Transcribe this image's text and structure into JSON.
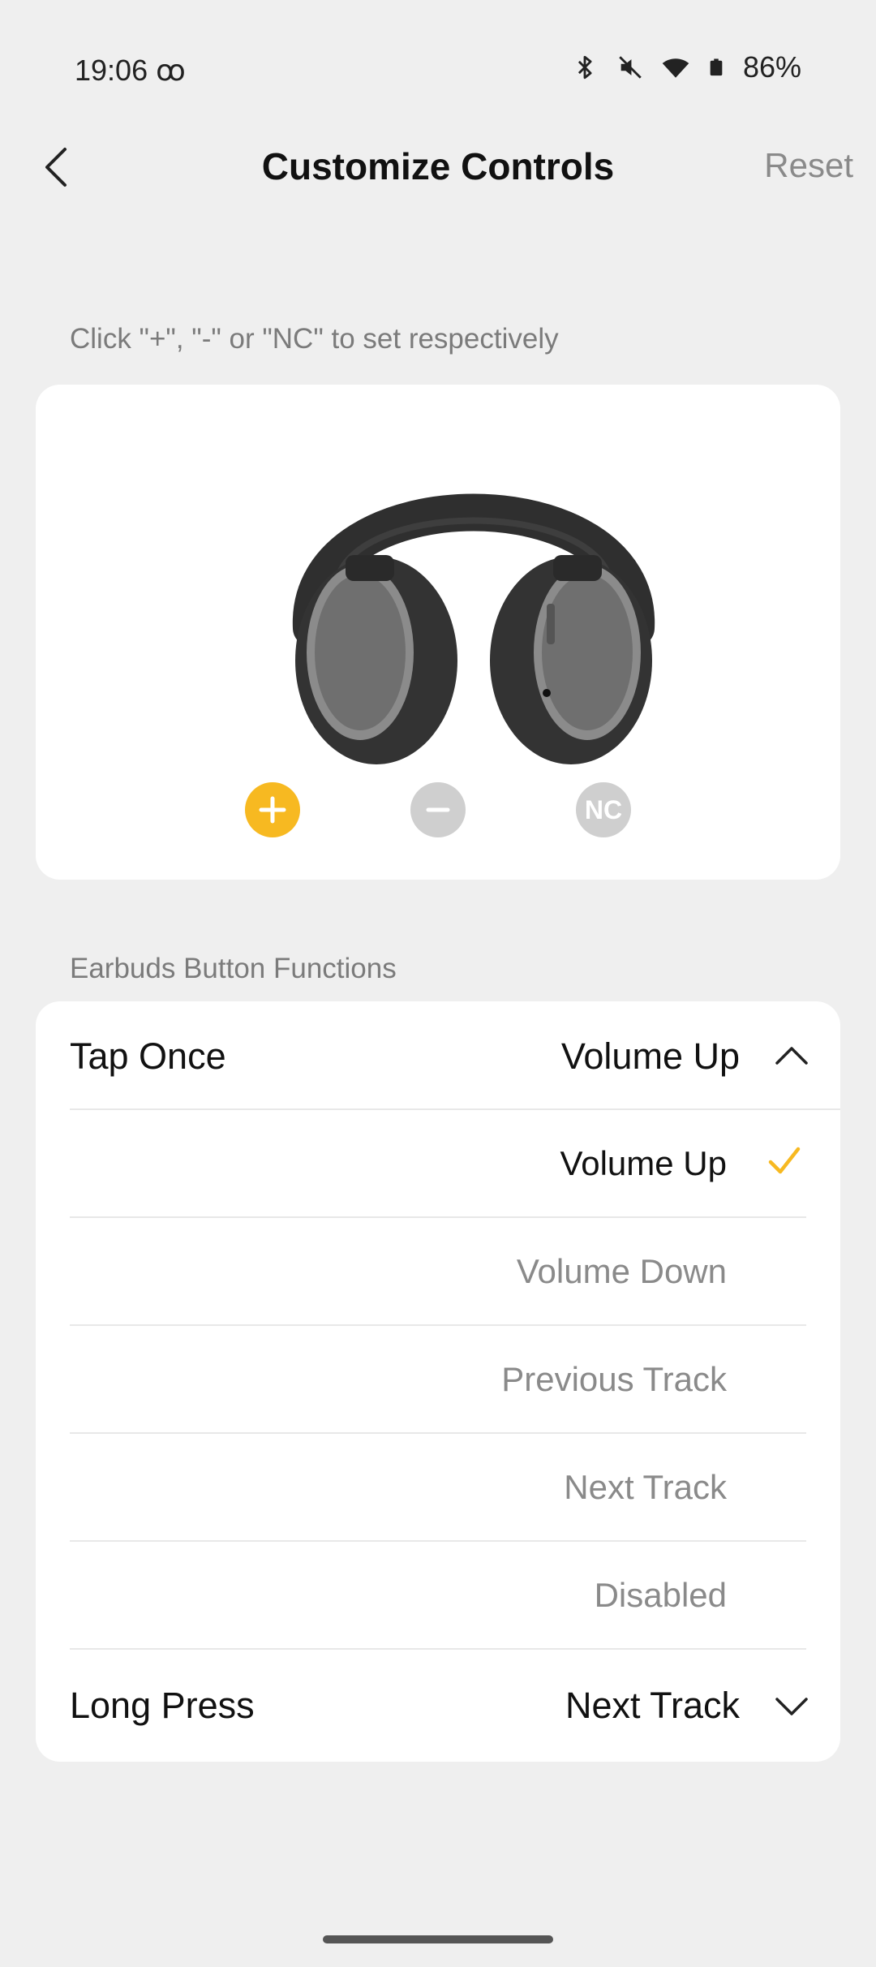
{
  "status_bar": {
    "time": "19:06",
    "carrier_glyph": "ꝏ",
    "battery_percent": "86%",
    "icons": [
      "bluetooth-icon",
      "mute-icon",
      "wifi-icon",
      "battery-icon"
    ]
  },
  "header": {
    "title": "Customize Controls",
    "reset_label": "Reset"
  },
  "hint": "Click \"+\", \"-\" or \"NC\" to set respectively",
  "controls": {
    "selected": "plus",
    "nc_label": "NC"
  },
  "section_label": "Earbuds Button Functions",
  "functions": {
    "tap_once": {
      "label": "Tap Once",
      "value": "Volume Up",
      "expanded": true
    },
    "options": [
      {
        "label": "Volume Up",
        "selected": true
      },
      {
        "label": "Volume Down",
        "selected": false
      },
      {
        "label": "Previous Track",
        "selected": false
      },
      {
        "label": "Next Track",
        "selected": false
      },
      {
        "label": "Disabled",
        "selected": false
      }
    ],
    "long_press": {
      "label": "Long Press",
      "value": "Next Track",
      "expanded": false
    }
  },
  "colors": {
    "accent": "#f7b921",
    "inactive": "#cfcfcf",
    "background": "#efefef",
    "card": "#ffffff"
  }
}
